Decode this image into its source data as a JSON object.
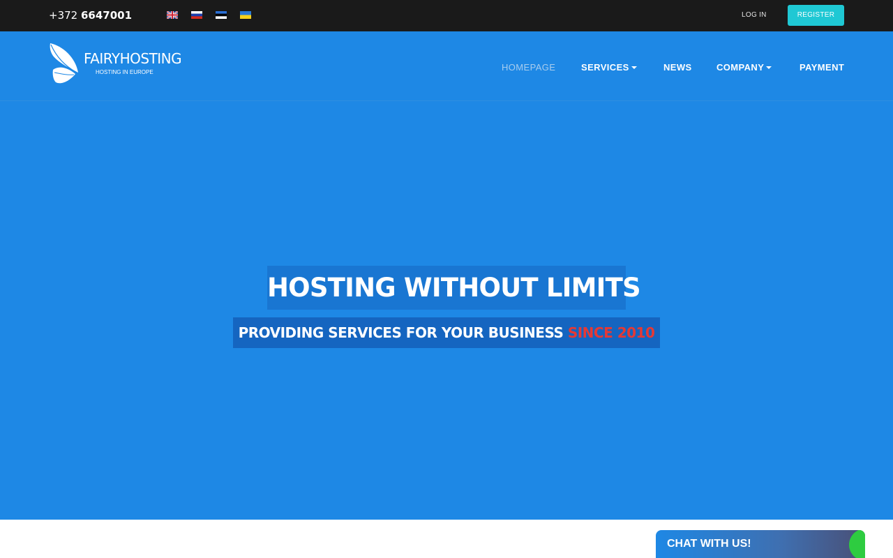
{
  "topbar": {
    "phone_prefix": "+372",
    "phone_number": "6647001",
    "languages": [
      {
        "code": "en",
        "icon": "uk-flag-icon"
      },
      {
        "code": "ru",
        "icon": "russia-flag-icon"
      },
      {
        "code": "et",
        "icon": "estonia-flag-icon"
      },
      {
        "code": "uk",
        "icon": "ukraine-flag-icon"
      }
    ],
    "login_label": "LOG IN",
    "register_label": "REGISTER",
    "colors": {
      "background": "#1a1a1a",
      "register_bg": "#1fc8d4"
    }
  },
  "header": {
    "logo": {
      "name_part1": "FAIRY",
      "name_part2": "HOSTING",
      "tagline": "HOSTING IN EUROPE",
      "icon": "butterfly-logo-icon"
    },
    "nav": [
      {
        "label": "HOMEPAGE",
        "active": true
      },
      {
        "label": "SERVICES",
        "dropdown": true
      },
      {
        "label": "NEWS"
      },
      {
        "label": "COMPANY",
        "dropdown": true
      },
      {
        "label": "PAYMENT"
      }
    ],
    "colors": {
      "background": "#1e88e5",
      "active_nav": "#a9cdee"
    }
  },
  "hero": {
    "title": "HOSTING WITHOUT LIMITS",
    "subtitle_main": "PROVIDING SERVICES FOR YOUR BUSINESS",
    "subtitle_accent": "SINCE 2010",
    "colors": {
      "background": "#1e88e5",
      "title_bg": "#1976d2",
      "subtitle_bg": "#1565c0",
      "accent": "#e53935"
    }
  },
  "chat": {
    "label": "CHAT WITH US!",
    "colors": {
      "indicator": "#2ecc40"
    }
  }
}
